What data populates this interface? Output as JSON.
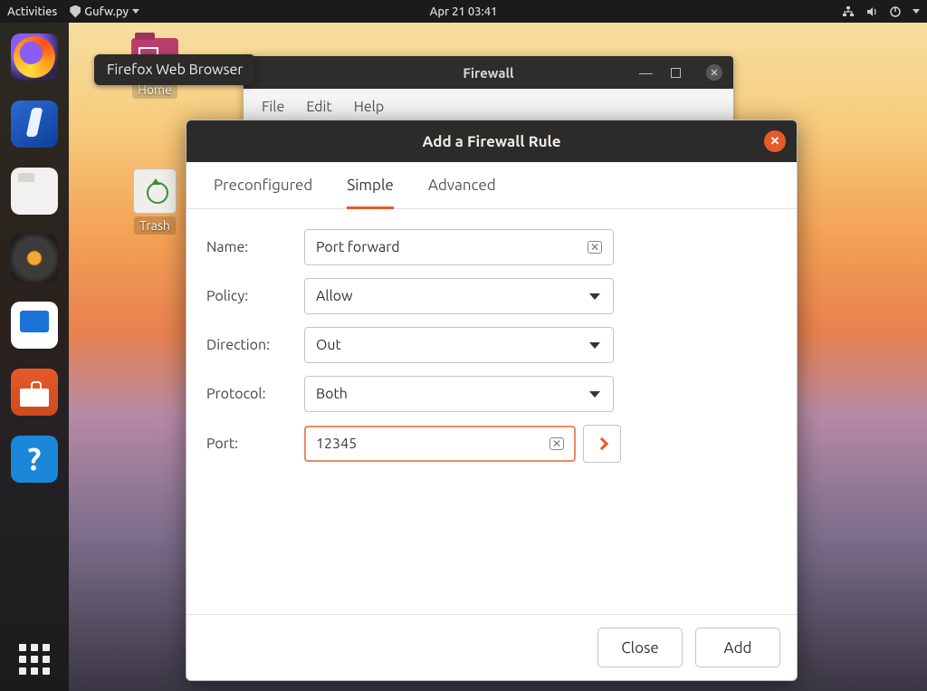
{
  "topbar": {
    "activities": "Activities",
    "app_name": "Gufw.py",
    "datetime": "Apr 21  03:41"
  },
  "tooltip": "Firefox Web Browser",
  "desktop": {
    "home": "Home",
    "trash": "Trash"
  },
  "firewall_window": {
    "title": "Firewall",
    "menu": {
      "file": "File",
      "edit": "Edit",
      "help": "Help"
    }
  },
  "dialog": {
    "title": "Add a Firewall Rule",
    "tabs": {
      "preconfigured": "Preconfigured",
      "simple": "Simple",
      "advanced": "Advanced"
    },
    "labels": {
      "name": "Name:",
      "policy": "Policy:",
      "direction": "Direction:",
      "protocol": "Protocol:",
      "port": "Port:"
    },
    "values": {
      "name": "Port forward",
      "policy": "Allow",
      "direction": "Out",
      "protocol": "Both",
      "port": "12345"
    },
    "buttons": {
      "close": "Close",
      "add": "Add"
    }
  },
  "dock_items": [
    "firefox",
    "thunderbird",
    "files",
    "rhythmbox",
    "libreoffice",
    "software",
    "help"
  ]
}
